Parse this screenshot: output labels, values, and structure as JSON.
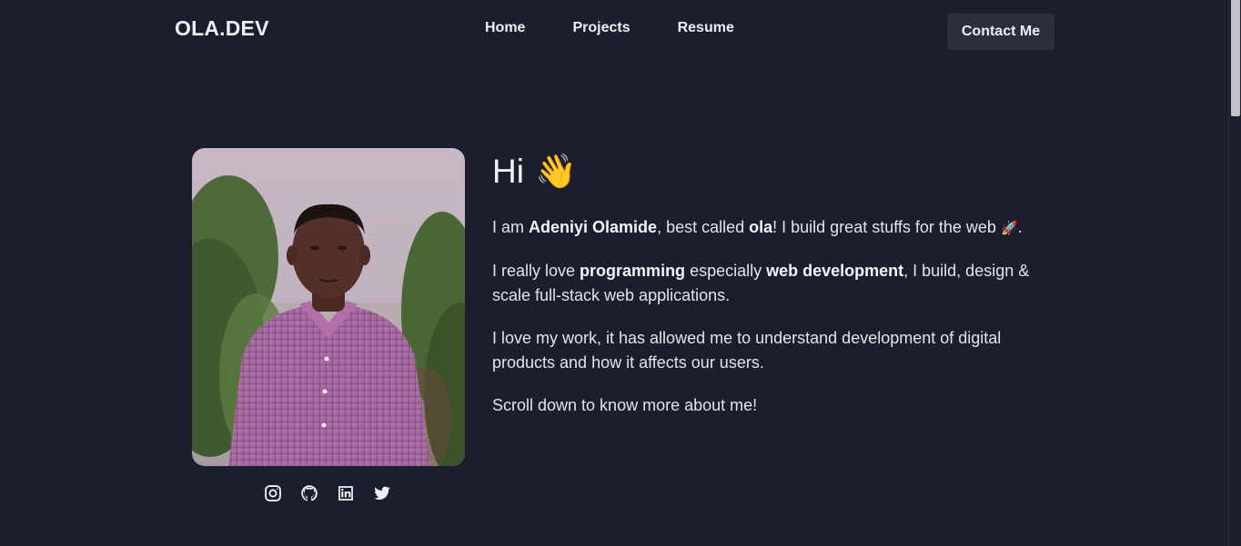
{
  "header": {
    "logo": "OLA.DEV",
    "nav": [
      {
        "label": "Home"
      },
      {
        "label": "Projects"
      },
      {
        "label": "Resume"
      }
    ],
    "contact_label": "Contact Me"
  },
  "intro": {
    "greeting": "Hi",
    "greeting_emoji": "👋",
    "p1": {
      "t1": "I am ",
      "name": "Adeniyi Olamide",
      "t2": ", best called ",
      "nickname": "ola",
      "t3": "! I build great stuffs for the web ",
      "emoji": "🚀",
      "t4": "."
    },
    "p2": {
      "t1": "I really love ",
      "b1": "programming",
      "t2": " especially ",
      "b2": "web development",
      "t3": ", I build, design & scale full-stack web applications."
    },
    "p3": "I love my work, it has allowed me to understand development of digital products and how it affects our users.",
    "p4": "Scroll down to know more about me!"
  },
  "socials": [
    {
      "icon": "instagram-icon"
    },
    {
      "icon": "github-icon"
    },
    {
      "icon": "linkedin-icon"
    },
    {
      "icon": "twitter-icon"
    }
  ],
  "colors": {
    "background": "#1b1e2c",
    "button_bg": "#2a2e3d",
    "text": "#eeeff3"
  }
}
